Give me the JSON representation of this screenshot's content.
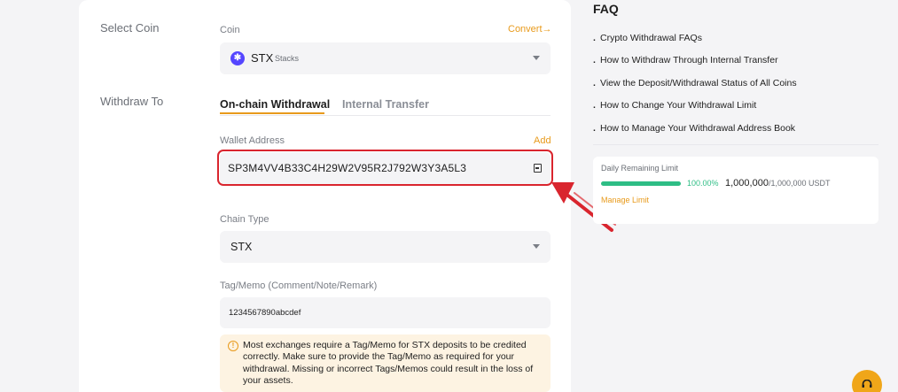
{
  "form": {
    "select_coin_label": "Select Coin",
    "coin_field_label": "Coin",
    "convert_link": "Convert",
    "convert_arrow": "→",
    "coin": {
      "icon_letter": "✱",
      "symbol": "STX",
      "name": "Stacks"
    },
    "withdraw_to_label": "Withdraw To",
    "tabs": [
      {
        "label": "On-chain Withdrawal",
        "active": true
      },
      {
        "label": "Internal Transfer",
        "active": false
      }
    ],
    "wallet_address_label": "Wallet Address",
    "add_link": "Add",
    "wallet_address_value": "SP3M4VV4B33C4H29W2V95R2J792W3Y3A5L3",
    "chain_type_label": "Chain Type",
    "chain_type_value": "STX",
    "memo_label": "Tag/Memo (Comment/Note/Remark)",
    "memo_value": "1234567890abcdef",
    "warning_text": "Most exchanges require a Tag/Memo for STX deposits to be credited correctly. Make sure to provide the Tag/Memo as required for your withdrawal. Missing or incorrect Tags/Memos could result in the loss of your assets."
  },
  "faq": {
    "title": "FAQ",
    "bullet": ".",
    "items": [
      "Crypto Withdrawal FAQs",
      "How to Withdraw Through Internal Transfer",
      "View the Deposit/Withdrawal Status of All Coins",
      "How to Change Your Withdrawal Limit",
      "How to Manage Your Withdrawal Address Book"
    ]
  },
  "limit": {
    "label": "Daily Remaining Limit",
    "percent_text": "100.00%",
    "progress_fraction": 1.0,
    "remaining": "1,000,000",
    "total": "/1,000,000 USDT",
    "manage_link": "Manage Limit"
  },
  "colors": {
    "accent": "#e89a1b",
    "highlight": "#d9252e",
    "success": "#2ebd85"
  },
  "icons": {
    "coin": "stacks-logo-icon",
    "address_book": "address-book-icon",
    "warning": "info-circle-icon",
    "support": "headset-icon",
    "annotation": "red-arrow-annotation"
  }
}
